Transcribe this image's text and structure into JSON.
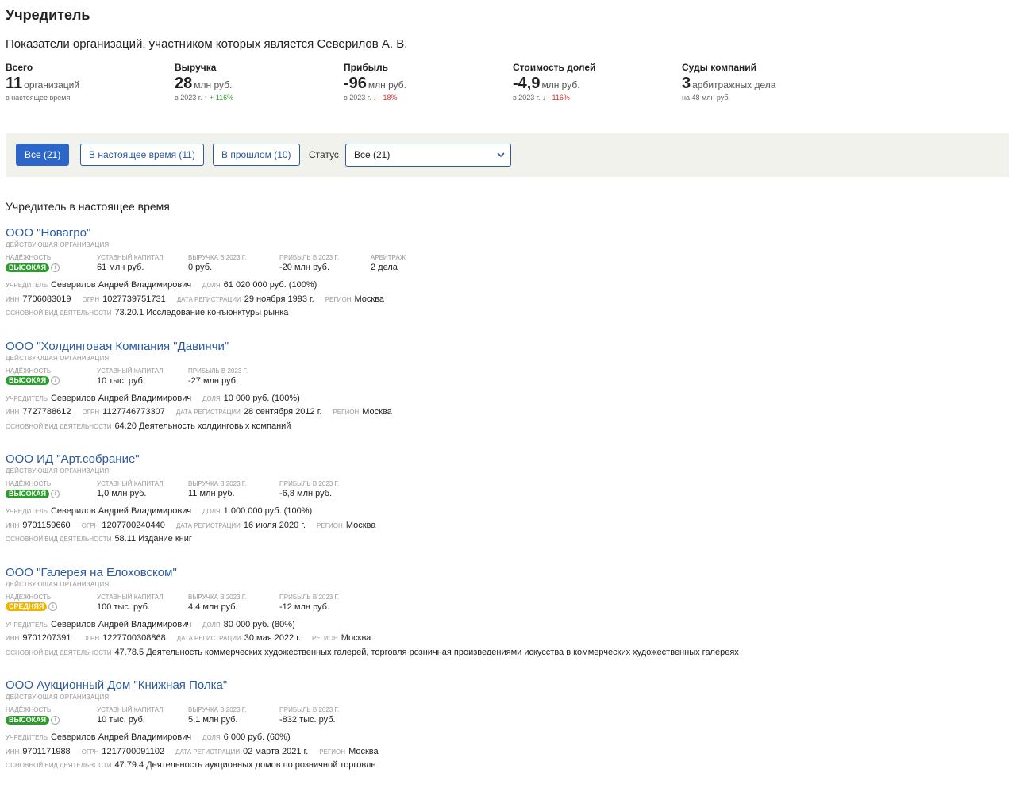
{
  "header": {
    "title": "Учредитель",
    "subtitle": "Показатели организаций, участником которых является Северилов А. В."
  },
  "stats": [
    {
      "label": "Всего",
      "value": "11",
      "unit": "организаций",
      "note": "в настоящее время",
      "change": "",
      "direction": ""
    },
    {
      "label": "Выручка",
      "value": "28",
      "unit": "млн руб.",
      "note": "в 2023 г.",
      "change": "↑ + 116%",
      "direction": "up"
    },
    {
      "label": "Прибыль",
      "value": "-96",
      "unit": "млн руб.",
      "note": "в 2023 г.",
      "change": "↓ - 18%",
      "direction": "down"
    },
    {
      "label": "Стоимость долей",
      "value": "-4,9",
      "unit": "млн руб.",
      "note": "в 2023 г.",
      "change": "↓ - 116%",
      "direction": "down"
    },
    {
      "label": "Суды компаний",
      "value": "3",
      "unit": "арбитражных дела",
      "note": "на 48 млн руб.",
      "change": "",
      "direction": ""
    }
  ],
  "filters": {
    "all": "Все (21)",
    "current": "В настоящее время (11)",
    "past": "В прошлом (10)",
    "status_label": "Статус",
    "status_value": "Все (21)"
  },
  "section_title": "Учредитель в настоящее время",
  "labels": {
    "reliability": "Надёжность",
    "capital": "Уставный капитал",
    "revenue": "Выручка в 2023 г.",
    "profit": "Прибыль в 2023 г.",
    "arbitration": "Арбитраж",
    "founder": "Учредитель",
    "share": "доля",
    "inn": "ИНН",
    "ogrn": "ОГРН",
    "reg_date": "Дата регистрации",
    "region": "Регион",
    "activity": "Основной вид деятельности"
  },
  "companies": [
    {
      "name": "ООО \"Новагро\"",
      "status": "Действующая организация",
      "reliability": "ВЫСОКАЯ",
      "reliability_level": "high",
      "capital": "61 млн руб.",
      "revenue": "0 руб.",
      "profit": "-20 млн руб.",
      "arbitration": "2 дела",
      "founder": "Северилов Андрей Владимирович",
      "share": "61 020 000 руб. (100%)",
      "inn": "7706083019",
      "ogrn": "1027739751731",
      "reg_date": "29 ноября 1993 г.",
      "region": "Москва",
      "activity": "73.20.1 Исследование конъюнктуры рынка"
    },
    {
      "name": "ООО \"Холдинговая Компания \"Давинчи\"",
      "status": "Действующая организация",
      "reliability": "ВЫСОКАЯ",
      "reliability_level": "high",
      "capital": "10 тыс. руб.",
      "profit": "-27 млн руб.",
      "founder": "Северилов Андрей Владимирович",
      "share": "10 000 руб. (100%)",
      "inn": "7727788612",
      "ogrn": "1127746773307",
      "reg_date": "28 сентября 2012 г.",
      "region": "Москва",
      "activity": "64.20 Деятельность холдинговых компаний"
    },
    {
      "name": "ООО ИД \"Арт.собрание\"",
      "status": "Действующая организация",
      "reliability": "ВЫСОКАЯ",
      "reliability_level": "high",
      "capital": "1,0 млн руб.",
      "revenue": "11 млн руб.",
      "profit": "-6,8 млн руб.",
      "founder": "Северилов Андрей Владимирович",
      "share": "1 000 000 руб. (100%)",
      "inn": "9701159660",
      "ogrn": "1207700240440",
      "reg_date": "16 июля 2020 г.",
      "region": "Москва",
      "activity": "58.11 Издание книг"
    },
    {
      "name": "ООО \"Галерея на Елоховском\"",
      "status": "Действующая организация",
      "reliability": "СРЕДНЯЯ",
      "reliability_level": "mid",
      "capital": "100 тыс. руб.",
      "revenue": "4,4 млн руб.",
      "profit": "-12 млн руб.",
      "founder": "Северилов Андрей Владимирович",
      "share": "80 000 руб. (80%)",
      "inn": "9701207391",
      "ogrn": "1227700308868",
      "reg_date": "30 мая 2022 г.",
      "region": "Москва",
      "activity": "47.78.5 Деятельность коммерческих художественных галерей, торговля розничная произведениями искусства в коммерческих художественных галереях"
    },
    {
      "name": "ООО Аукционный Дом \"Книжная Полка\"",
      "status": "Действующая организация",
      "reliability": "ВЫСОКАЯ",
      "reliability_level": "high",
      "capital": "10 тыс. руб.",
      "revenue": "5,1 млн руб.",
      "profit": "-832 тыс. руб.",
      "founder": "Северилов Андрей Владимирович",
      "share": "6 000 руб. (60%)",
      "inn": "9701171988",
      "ogrn": "1217700091102",
      "reg_date": "02 марта 2021 г.",
      "region": "Москва",
      "activity": "47.79.4 Деятельность аукционных домов по розничной торговле"
    }
  ]
}
